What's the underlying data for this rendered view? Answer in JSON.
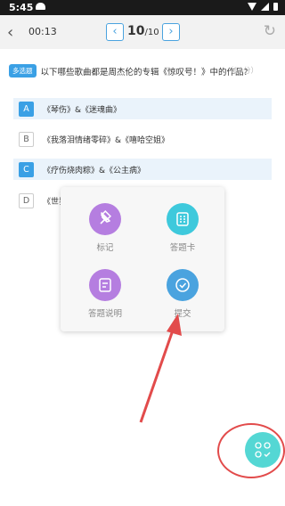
{
  "status": {
    "time": "5:45"
  },
  "header": {
    "timer": "00:13",
    "page_current": "10",
    "page_total": "/10"
  },
  "question": {
    "badge": "多选题",
    "text": "以下哪些歌曲都是周杰伦的专辑《惊叹号！》中的作品?",
    "score": "（10分）"
  },
  "options": [
    {
      "letter": "A",
      "text": "《琴伤》&《迷魂曲》",
      "selected": true
    },
    {
      "letter": "B",
      "text": "《我落泪情绪零碎》&《嘻哈空姐》",
      "selected": false
    },
    {
      "letter": "C",
      "text": "《疗伤烧肉粽》&《公主病》",
      "selected": true
    },
    {
      "letter": "D",
      "text": "《世界",
      "selected": false
    }
  ],
  "menu": {
    "mark": "标记",
    "answer_card": "答题卡",
    "instructions": "答题说明",
    "submit": "提交"
  },
  "colors": {
    "accent": "#3aa0e5",
    "fab": "#54d7d4",
    "annotation": "#e24b4b"
  }
}
